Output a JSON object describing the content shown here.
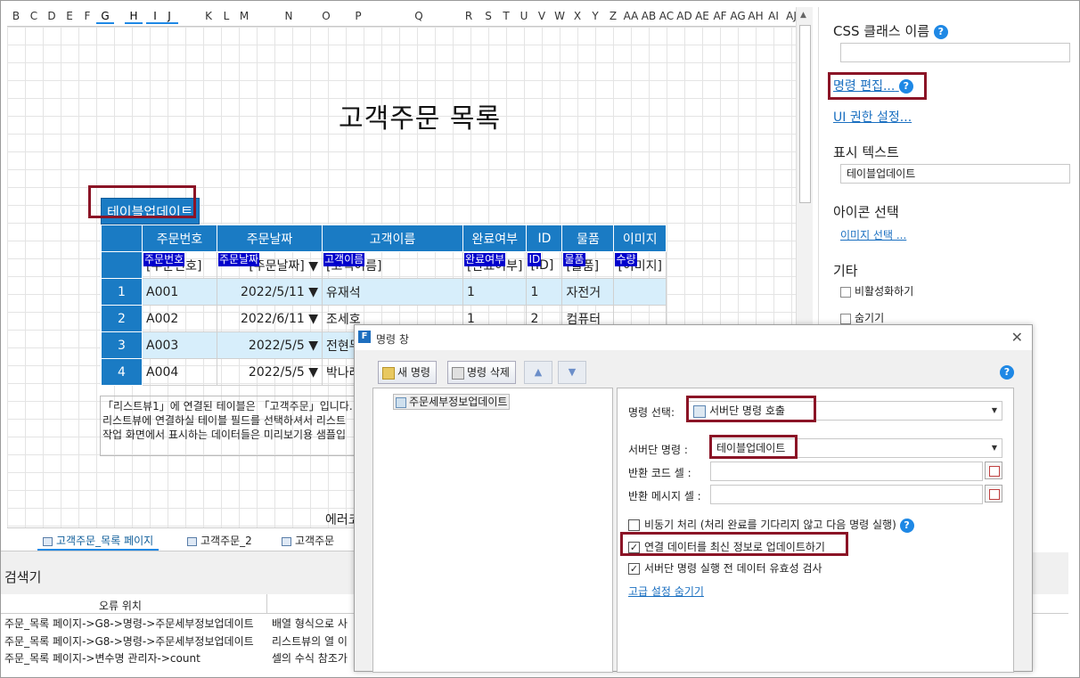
{
  "sheet": {
    "columns": [
      "B",
      "C",
      "D",
      "E",
      "F",
      "G",
      "H",
      "I",
      "J",
      "K",
      "L",
      "M",
      "N",
      "O",
      "P",
      "Q",
      "R",
      "S",
      "T",
      "U",
      "V",
      "W",
      "X",
      "Y",
      "Z",
      "AA",
      "AB",
      "AC",
      "AD",
      "AE",
      "AF",
      "AG",
      "AH",
      "AI",
      "AJ"
    ],
    "title": "고객주문 목록",
    "update_button": "테이블업데이트",
    "table": {
      "headers": [
        "주문번호",
        "주문날짜",
        "고객이름",
        "완료여부",
        "ID",
        "물품",
        "이미지"
      ],
      "bind_row": [
        "[주문번호]",
        "[주문날짜]",
        "[고객이름]",
        "[완료여부]",
        "[ID]",
        "[물품]",
        "[이미지]"
      ],
      "bind_tags": [
        "주문번호",
        "주문날짜",
        "고객이름",
        "완료여부",
        "ID",
        "물품",
        "수량"
      ],
      "rows": [
        {
          "num": "1",
          "order": "A001",
          "date": "2022/5/11",
          "name": "유재석",
          "done": "1",
          "id": "1",
          "item": "자전거"
        },
        {
          "num": "2",
          "order": "A002",
          "date": "2022/6/11",
          "name": "조세호",
          "done": "1",
          "id": "2",
          "item": "컴퓨터"
        },
        {
          "num": "3",
          "order": "A003",
          "date": "2022/5/5",
          "name": "전현무",
          "done": "",
          "id": "",
          "item": ""
        },
        {
          "num": "4",
          "order": "A004",
          "date": "2022/5/5",
          "name": "박나래",
          "done": "",
          "id": "",
          "item": ""
        }
      ]
    },
    "note_lines": [
      "「리스트뷰1」에 연결된 테이블은 「고객주문」입니다.",
      "리스트뷰에 연결하실 테이블 필드를 선택하셔서 리스트",
      "작업 화면에서 표시하는 데이터들은 미리보기용 샘플입"
    ],
    "error_code_label": "에러코"
  },
  "tabs": [
    "고객주문_목록 페이지",
    "고객주문_2",
    "고객주문"
  ],
  "lower": {
    "title": "검색기",
    "col_location": "오류 위치",
    "rows": [
      {
        "loc": "주문_목록 페이지->G8->명령->주문세부정보업데이트",
        "msg": "배열 형식으로 사"
      },
      {
        "loc": "주문_목록 페이지->G8->명령->주문세부정보업데이트",
        "msg": "리스트뷰의 열 이"
      },
      {
        "loc": "주문_목록 페이지->변수명 관리자->count",
        "msg": "셀의 수식 참조가"
      }
    ]
  },
  "props": {
    "css_class_label": "CSS 클래스 이름",
    "edit_command": "명령 편집...",
    "ui_permission": "UI 권한 설정...",
    "display_text_label": "표시 텍스트",
    "display_text_value": "테이블업데이트",
    "icon_label": "아이콘 선택",
    "image_select": "이미지 선택 ...",
    "etc_label": "기타",
    "disable": "비활성화하기",
    "hide": "숨기기"
  },
  "dialog": {
    "title": "명령 창",
    "new_command": "새 명령",
    "delete_command": "명령 삭제",
    "list_item": "주문세부정보업데이트",
    "command_select_label": "명령 선택:",
    "command_select_value": "서버단 명령 호출",
    "server_command_label": "서버단 명령 :",
    "server_command_value": "테이블업데이트",
    "return_code_label": "반환 코드 셀 :",
    "return_msg_label": "반환 메시지 셀 :",
    "async_label": "비동기 처리 (처리 완료를 기다리지 않고 다음 명령 실행)",
    "refresh_label": "연결 데이터를 최신 정보로 업데이트하기",
    "validate_label": "서버단 명령 실행 전 데이터 유효성 검사",
    "advanced_link": "고급 설정 숨기기"
  }
}
